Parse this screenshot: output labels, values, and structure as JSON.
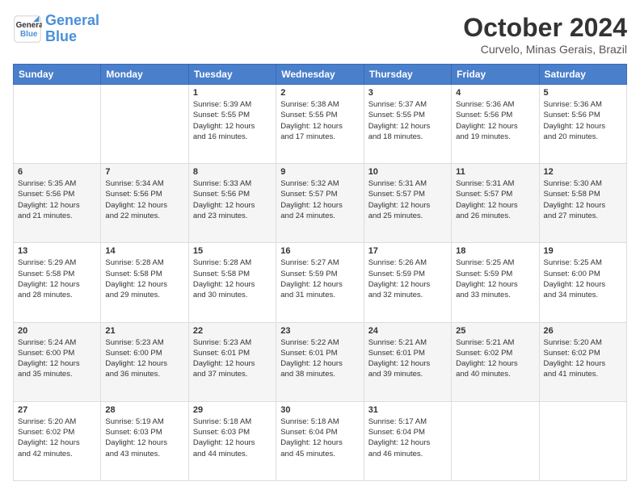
{
  "logo": {
    "line1": "General",
    "line2": "Blue"
  },
  "title": "October 2024",
  "location": "Curvelo, Minas Gerais, Brazil",
  "days_header": [
    "Sunday",
    "Monday",
    "Tuesday",
    "Wednesday",
    "Thursday",
    "Friday",
    "Saturday"
  ],
  "weeks": [
    [
      {
        "day": "",
        "info": ""
      },
      {
        "day": "",
        "info": ""
      },
      {
        "day": "1",
        "info": "Sunrise: 5:39 AM\nSunset: 5:55 PM\nDaylight: 12 hours\nand 16 minutes."
      },
      {
        "day": "2",
        "info": "Sunrise: 5:38 AM\nSunset: 5:55 PM\nDaylight: 12 hours\nand 17 minutes."
      },
      {
        "day": "3",
        "info": "Sunrise: 5:37 AM\nSunset: 5:55 PM\nDaylight: 12 hours\nand 18 minutes."
      },
      {
        "day": "4",
        "info": "Sunrise: 5:36 AM\nSunset: 5:56 PM\nDaylight: 12 hours\nand 19 minutes."
      },
      {
        "day": "5",
        "info": "Sunrise: 5:36 AM\nSunset: 5:56 PM\nDaylight: 12 hours\nand 20 minutes."
      }
    ],
    [
      {
        "day": "6",
        "info": "Sunrise: 5:35 AM\nSunset: 5:56 PM\nDaylight: 12 hours\nand 21 minutes."
      },
      {
        "day": "7",
        "info": "Sunrise: 5:34 AM\nSunset: 5:56 PM\nDaylight: 12 hours\nand 22 minutes."
      },
      {
        "day": "8",
        "info": "Sunrise: 5:33 AM\nSunset: 5:56 PM\nDaylight: 12 hours\nand 23 minutes."
      },
      {
        "day": "9",
        "info": "Sunrise: 5:32 AM\nSunset: 5:57 PM\nDaylight: 12 hours\nand 24 minutes."
      },
      {
        "day": "10",
        "info": "Sunrise: 5:31 AM\nSunset: 5:57 PM\nDaylight: 12 hours\nand 25 minutes."
      },
      {
        "day": "11",
        "info": "Sunrise: 5:31 AM\nSunset: 5:57 PM\nDaylight: 12 hours\nand 26 minutes."
      },
      {
        "day": "12",
        "info": "Sunrise: 5:30 AM\nSunset: 5:58 PM\nDaylight: 12 hours\nand 27 minutes."
      }
    ],
    [
      {
        "day": "13",
        "info": "Sunrise: 5:29 AM\nSunset: 5:58 PM\nDaylight: 12 hours\nand 28 minutes."
      },
      {
        "day": "14",
        "info": "Sunrise: 5:28 AM\nSunset: 5:58 PM\nDaylight: 12 hours\nand 29 minutes."
      },
      {
        "day": "15",
        "info": "Sunrise: 5:28 AM\nSunset: 5:58 PM\nDaylight: 12 hours\nand 30 minutes."
      },
      {
        "day": "16",
        "info": "Sunrise: 5:27 AM\nSunset: 5:59 PM\nDaylight: 12 hours\nand 31 minutes."
      },
      {
        "day": "17",
        "info": "Sunrise: 5:26 AM\nSunset: 5:59 PM\nDaylight: 12 hours\nand 32 minutes."
      },
      {
        "day": "18",
        "info": "Sunrise: 5:25 AM\nSunset: 5:59 PM\nDaylight: 12 hours\nand 33 minutes."
      },
      {
        "day": "19",
        "info": "Sunrise: 5:25 AM\nSunset: 6:00 PM\nDaylight: 12 hours\nand 34 minutes."
      }
    ],
    [
      {
        "day": "20",
        "info": "Sunrise: 5:24 AM\nSunset: 6:00 PM\nDaylight: 12 hours\nand 35 minutes."
      },
      {
        "day": "21",
        "info": "Sunrise: 5:23 AM\nSunset: 6:00 PM\nDaylight: 12 hours\nand 36 minutes."
      },
      {
        "day": "22",
        "info": "Sunrise: 5:23 AM\nSunset: 6:01 PM\nDaylight: 12 hours\nand 37 minutes."
      },
      {
        "day": "23",
        "info": "Sunrise: 5:22 AM\nSunset: 6:01 PM\nDaylight: 12 hours\nand 38 minutes."
      },
      {
        "day": "24",
        "info": "Sunrise: 5:21 AM\nSunset: 6:01 PM\nDaylight: 12 hours\nand 39 minutes."
      },
      {
        "day": "25",
        "info": "Sunrise: 5:21 AM\nSunset: 6:02 PM\nDaylight: 12 hours\nand 40 minutes."
      },
      {
        "day": "26",
        "info": "Sunrise: 5:20 AM\nSunset: 6:02 PM\nDaylight: 12 hours\nand 41 minutes."
      }
    ],
    [
      {
        "day": "27",
        "info": "Sunrise: 5:20 AM\nSunset: 6:02 PM\nDaylight: 12 hours\nand 42 minutes."
      },
      {
        "day": "28",
        "info": "Sunrise: 5:19 AM\nSunset: 6:03 PM\nDaylight: 12 hours\nand 43 minutes."
      },
      {
        "day": "29",
        "info": "Sunrise: 5:18 AM\nSunset: 6:03 PM\nDaylight: 12 hours\nand 44 minutes."
      },
      {
        "day": "30",
        "info": "Sunrise: 5:18 AM\nSunset: 6:04 PM\nDaylight: 12 hours\nand 45 minutes."
      },
      {
        "day": "31",
        "info": "Sunrise: 5:17 AM\nSunset: 6:04 PM\nDaylight: 12 hours\nand 46 minutes."
      },
      {
        "day": "",
        "info": ""
      },
      {
        "day": "",
        "info": ""
      }
    ]
  ]
}
